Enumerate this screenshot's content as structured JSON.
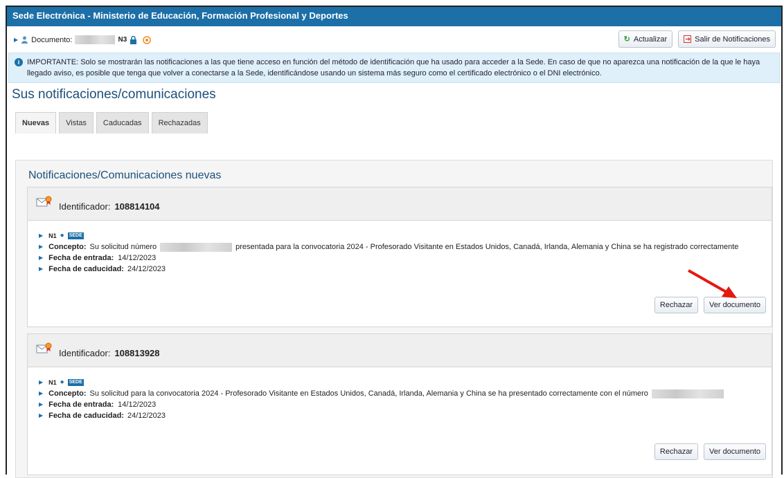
{
  "header": {
    "title": "Sede Electrónica - Ministerio de Educación, Formación Profesional y Deportes"
  },
  "docbar": {
    "label": "Documento:",
    "level": "N3",
    "refresh_label": "Actualizar",
    "exit_label": "Salir de Notificaciones"
  },
  "notice": {
    "text": "IMPORTANTE: Solo se mostrarán las notificaciones a las que tiene acceso en función del método de identificación que ha usado para acceder a la Sede. En caso de que no aparezca una notificación de la que le haya llegado aviso, es posible que tenga que volver a conectarse a la Sede, identificándose usando un sistema más seguro como el certificado electrónico o el DNI electrónico."
  },
  "page_title": "Sus notificaciones/comunicaciones",
  "tabs": [
    {
      "label": "Nuevas"
    },
    {
      "label": "Vistas"
    },
    {
      "label": "Caducadas"
    },
    {
      "label": "Rechazadas"
    }
  ],
  "panel": {
    "subtitle": "Notificaciones/Comunicaciones nuevas"
  },
  "notifications": [
    {
      "id_label": "Identificador:",
      "id": "108814104",
      "level": "N1",
      "badge": "SEDE",
      "concept_label": "Concepto:",
      "concept_pre": "Su solicitud número",
      "concept_post": "presentada para la convocatoria 2024 - Profesorado Visitante en Estados Unidos, Canadá, Irlanda, Alemania y China se ha registrado correctamente",
      "entry_label": "Fecha de entrada:",
      "entry_date": "14/12/2023",
      "expiry_label": "Fecha de caducidad:",
      "expiry_date": "24/12/2023",
      "reject_label": "Rechazar",
      "view_label": "Ver documento"
    },
    {
      "id_label": "Identificador:",
      "id": "108813928",
      "level": "N1",
      "badge": "SEDE",
      "concept_label": "Concepto:",
      "concept_pre": "Su solicitud para la convocatoria 2024 - Profesorado Visitante en Estados Unidos, Canadá, Irlanda, Alemania y China se ha presentado correctamente con el número",
      "concept_post": "",
      "entry_label": "Fecha de entrada:",
      "entry_date": "14/12/2023",
      "expiry_label": "Fecha de caducidad:",
      "expiry_date": "24/12/2023",
      "reject_label": "Rechazar",
      "view_label": "Ver documento"
    }
  ],
  "colors": {
    "header": "#1c6fa7",
    "title": "#1c4f7a",
    "arrow": "#e5190f"
  }
}
